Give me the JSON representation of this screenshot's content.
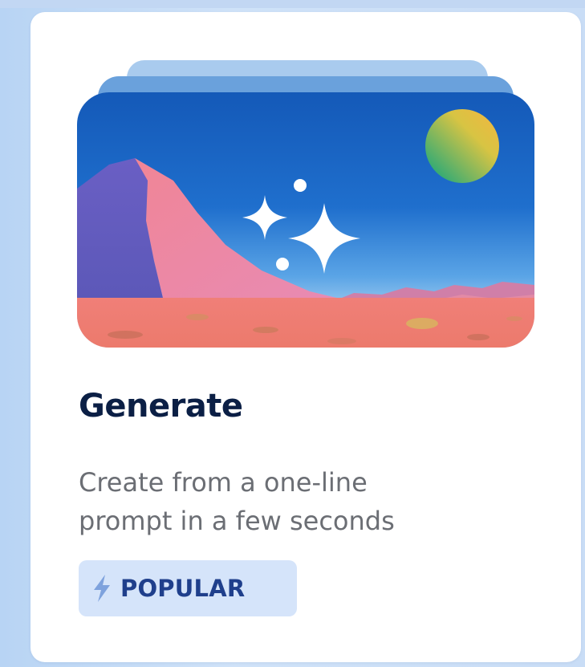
{
  "card": {
    "title": "Generate",
    "description_lines": [
      "Create from a one-line",
      "prompt in a few seconds"
    ],
    "badge": {
      "icon": "lightning-bolt-icon",
      "label": "POPULAR"
    },
    "illustration": {
      "subject": "desert-landscape-with-sparkles",
      "icons": [
        "sparkles-icon",
        "sun-icon"
      ]
    }
  },
  "colors": {
    "title": "#0b1f45",
    "description": "#6b6e74",
    "badge_background": "#d5e4fa",
    "badge_text": "#1f3f8c",
    "sky_top": "#1459b8",
    "sand": "#ee7e73"
  }
}
